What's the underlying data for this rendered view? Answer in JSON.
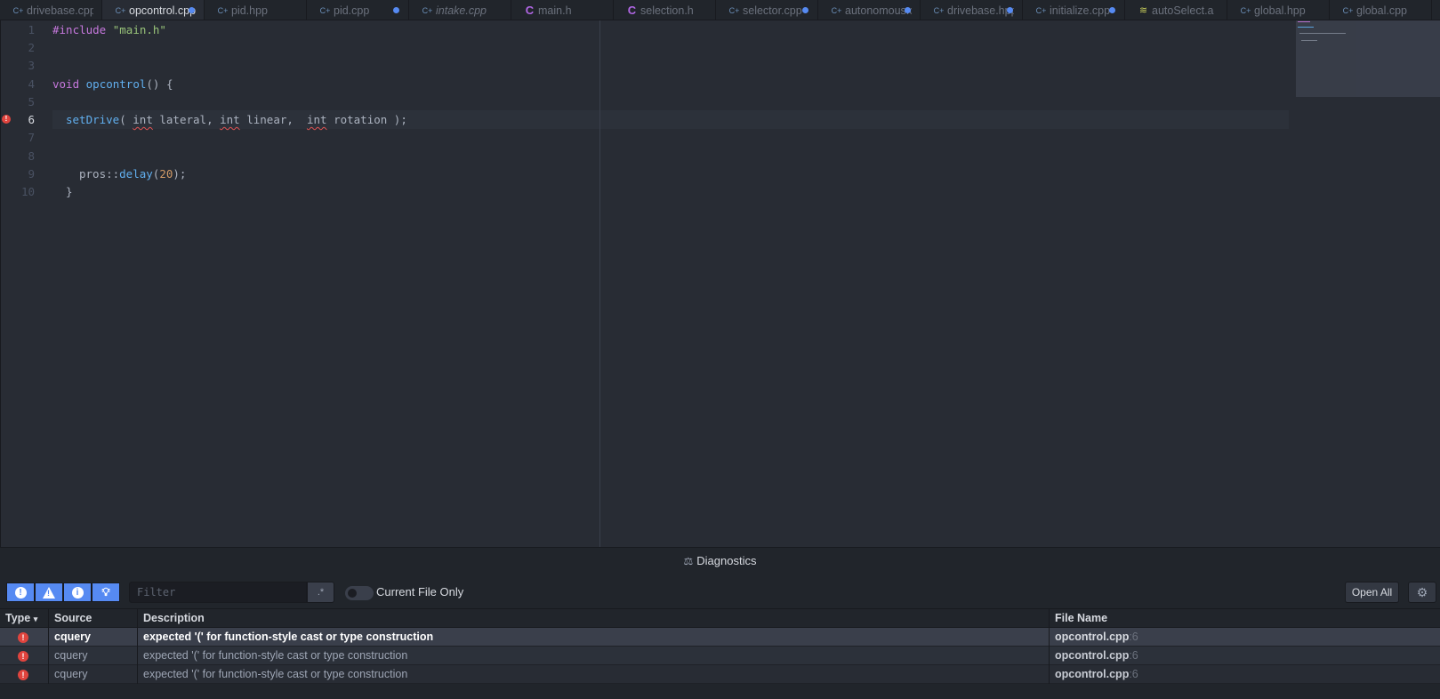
{
  "tabs": [
    {
      "label": "drivebase.cpp",
      "icon": "cpp-file-icon",
      "modified": false,
      "active": false,
      "italic": false
    },
    {
      "label": "opcontrol.cpp",
      "icon": "cpp-file-icon",
      "modified": true,
      "active": true,
      "italic": false
    },
    {
      "label": "pid.hpp",
      "icon": "cpp-file-icon",
      "modified": false,
      "active": false,
      "italic": false
    },
    {
      "label": "pid.cpp",
      "icon": "cpp-file-icon",
      "modified": true,
      "active": false,
      "italic": false
    },
    {
      "label": "intake.cpp",
      "icon": "cpp-file-icon",
      "modified": false,
      "active": false,
      "italic": true
    },
    {
      "label": "main.h",
      "icon": "c-file-icon",
      "modified": false,
      "active": false,
      "italic": false
    },
    {
      "label": "selection.h",
      "icon": "c-file-icon",
      "modified": false,
      "active": false,
      "italic": false
    },
    {
      "label": "selector.cpp",
      "icon": "cpp-file-icon",
      "modified": true,
      "active": false,
      "italic": false
    },
    {
      "label": "autonomous.cpp",
      "icon": "cpp-file-icon",
      "modified": true,
      "active": false,
      "italic": false
    },
    {
      "label": "drivebase.hpp",
      "icon": "cpp-file-icon",
      "modified": true,
      "active": false,
      "italic": false
    },
    {
      "label": "initialize.cpp",
      "icon": "cpp-file-icon",
      "modified": true,
      "active": false,
      "italic": false
    },
    {
      "label": "autoSelect.a",
      "icon": "yaml-file-icon",
      "modified": false,
      "active": false,
      "italic": false
    },
    {
      "label": "global.hpp",
      "icon": "cpp-file-icon",
      "modified": false,
      "active": false,
      "italic": false
    },
    {
      "label": "global.cpp",
      "icon": "cpp-file-icon",
      "modified": false,
      "active": false,
      "italic": false
    }
  ],
  "editor": {
    "line_numbers": [
      "1",
      "2",
      "3",
      "4",
      "5",
      "6",
      "7",
      "8",
      "9",
      "10"
    ],
    "current_line": "6",
    "code": {
      "l1_kw": "#include",
      "l1_str": "\"main.h\"",
      "l4_kw": "void",
      "l4_fn": "opcontrol",
      "l4_rest": "() {",
      "l6_fn": "setDrive",
      "l6_p1": "( ",
      "l6_t1": "int",
      "l6_p2": " lateral, ",
      "l6_t2": "int",
      "l6_p3": " linear,  ",
      "l6_t3": "int",
      "l6_p4": " rotation );",
      "l9_ns": "pros::",
      "l9_fn": "delay",
      "l9_p1": "(",
      "l9_num": "20",
      "l9_p2": ");",
      "l10": "}"
    }
  },
  "diagnostics": {
    "title": "Diagnostics",
    "filter_placeholder": "Filter",
    "regex_label": ".*",
    "current_file_only": "Current File Only",
    "open_all": "Open All",
    "columns": {
      "type": "Type",
      "source": "Source",
      "description": "Description",
      "file": "File Name"
    },
    "rows": [
      {
        "source": "cquery",
        "description": "expected '(' for function-style cast or type construction",
        "file": "opcontrol.cpp",
        "line": ":6"
      },
      {
        "source": "cquery",
        "description": "expected '(' for function-style cast or type construction",
        "file": "opcontrol.cpp",
        "line": ":6"
      },
      {
        "source": "cquery",
        "description": "expected '(' for function-style cast or type construction",
        "file": "opcontrol.cpp",
        "line": ":6"
      }
    ]
  },
  "colors": {
    "accent": "#568af2",
    "error": "#e0443e",
    "background": "#282c34"
  }
}
